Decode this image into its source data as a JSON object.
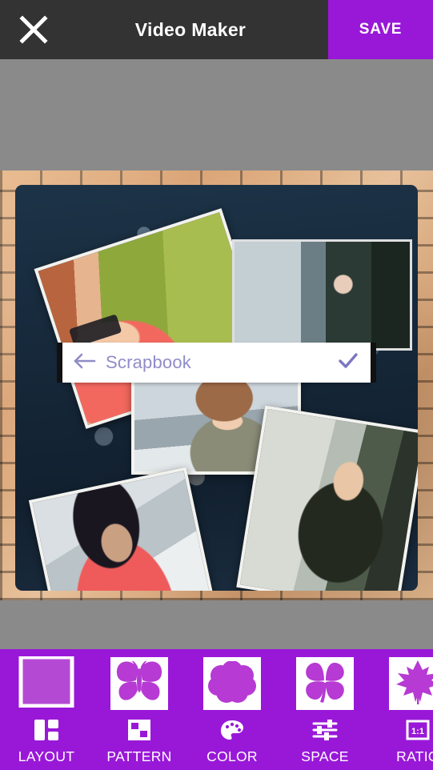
{
  "topbar": {
    "close_icon": "close-icon",
    "title": "Video Maker",
    "save_label": "SAVE",
    "save_bg": "#9918d8",
    "bar_bg": "#333333"
  },
  "preview": {
    "background_color": "#8a8a8a",
    "overlay_bar": {
      "back_icon": "arrow-left-icon",
      "title": "Scrapbook",
      "confirm_icon": "check-icon",
      "title_color": "#8f8cc8"
    },
    "collage": {
      "frame_style": "brick-wall",
      "photos": [
        {
          "name": "photo-glasses-red"
        },
        {
          "name": "photo-dark-scarf"
        },
        {
          "name": "photo-hat"
        },
        {
          "name": "photo-tiedye"
        },
        {
          "name": "photo-jacket"
        }
      ]
    }
  },
  "toolbar": {
    "background": "#9918d8",
    "items": [
      {
        "label": "LAYOUT",
        "thumb": "square-outline-shape",
        "icon": "layout-grid-icon"
      },
      {
        "label": "PATTERN",
        "thumb": "butterfly-shape",
        "icon": "checkerboard-icon"
      },
      {
        "label": "COLOR",
        "thumb": "flower-blob-shape",
        "icon": "palette-icon"
      },
      {
        "label": "SPACE",
        "thumb": "clover-shape",
        "icon": "sliders-icon"
      },
      {
        "label": "RATIO",
        "thumb": "maple-leaf-shape",
        "icon": "aspect-ratio-icon",
        "icon_text": "1:1"
      }
    ]
  }
}
